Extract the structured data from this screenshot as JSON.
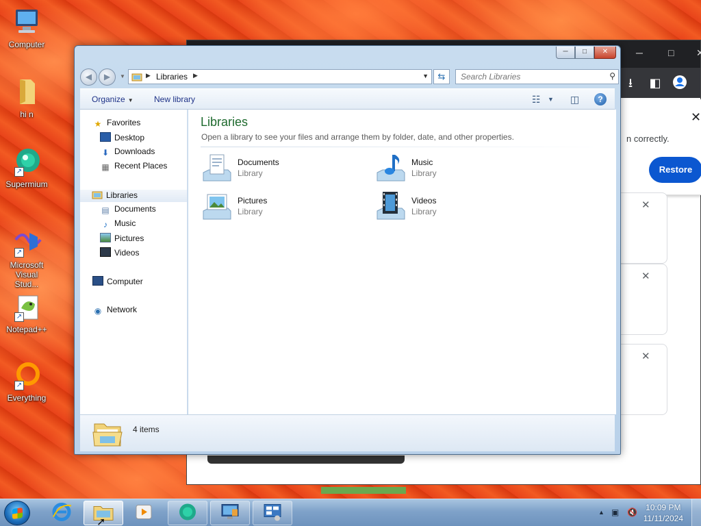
{
  "desktop": {
    "icons": [
      {
        "label": "Computer"
      },
      {
        "label": "hi n"
      },
      {
        "label": "Supermium"
      },
      {
        "label": "Microsoft Visual Stud..."
      },
      {
        "label": "Notepad++"
      },
      {
        "label": "Everything"
      }
    ]
  },
  "browser_bg": {
    "restore_text": "n correctly.",
    "restore_button": "Restore",
    "close_glyph": "✕"
  },
  "explorer": {
    "caption": {
      "minimize": "─",
      "maximize": "□",
      "close": "✕"
    },
    "address": {
      "crumb": "Libraries"
    },
    "search": {
      "placeholder": "Search Libraries"
    },
    "commands": {
      "organize": "Organize",
      "new_library": "New library",
      "help": "?"
    },
    "nav": {
      "favorites": "Favorites",
      "desktop": "Desktop",
      "downloads": "Downloads",
      "recent_places": "Recent Places",
      "libraries": "Libraries",
      "documents": "Documents",
      "music": "Music",
      "pictures": "Pictures",
      "videos": "Videos",
      "computer": "Computer",
      "network": "Network"
    },
    "content": {
      "title": "Libraries",
      "subtitle": "Open a library to see your files and arrange them by folder, date, and other properties.",
      "items": [
        {
          "name": "Documents",
          "type": "Library"
        },
        {
          "name": "Music",
          "type": "Library"
        },
        {
          "name": "Pictures",
          "type": "Library"
        },
        {
          "name": "Videos",
          "type": "Library"
        }
      ]
    },
    "details": {
      "count": "4 items"
    }
  },
  "taskbar": {
    "clock_time": "10:09 PM",
    "clock_date": "11/11/2024"
  },
  "colors": {
    "accent_blue": "#0b57d0",
    "library_title_green": "#1e6a2e",
    "command_text": "#1e3287"
  }
}
